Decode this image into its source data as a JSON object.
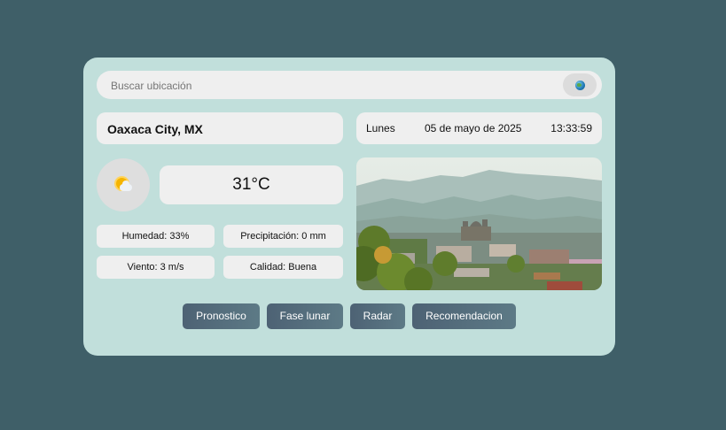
{
  "search": {
    "placeholder": "Buscar ubicación",
    "button_icon": "globe-icon"
  },
  "location": {
    "city": "Oaxaca City, MX"
  },
  "datetime": {
    "day": "Lunes",
    "date": "05 de mayo de 2025",
    "time": "13:33:59"
  },
  "weather": {
    "icon": "partly-cloudy-icon",
    "temperature": "31°C",
    "humidity": "Humedad: 33%",
    "precipitation": "Precipitación: 0 mm",
    "wind": "Viento: 3 m/s",
    "quality": "Calidad: Buena"
  },
  "city_photo": {
    "description_icon": "city-photo"
  },
  "actions": {
    "forecast": "Pronostico",
    "moon_phase": "Fase lunar",
    "radar": "Radar",
    "recommendation": "Recomendacion"
  },
  "colors": {
    "background": "#3f5f68",
    "card": "#c1dfdb",
    "button": "#516877"
  }
}
